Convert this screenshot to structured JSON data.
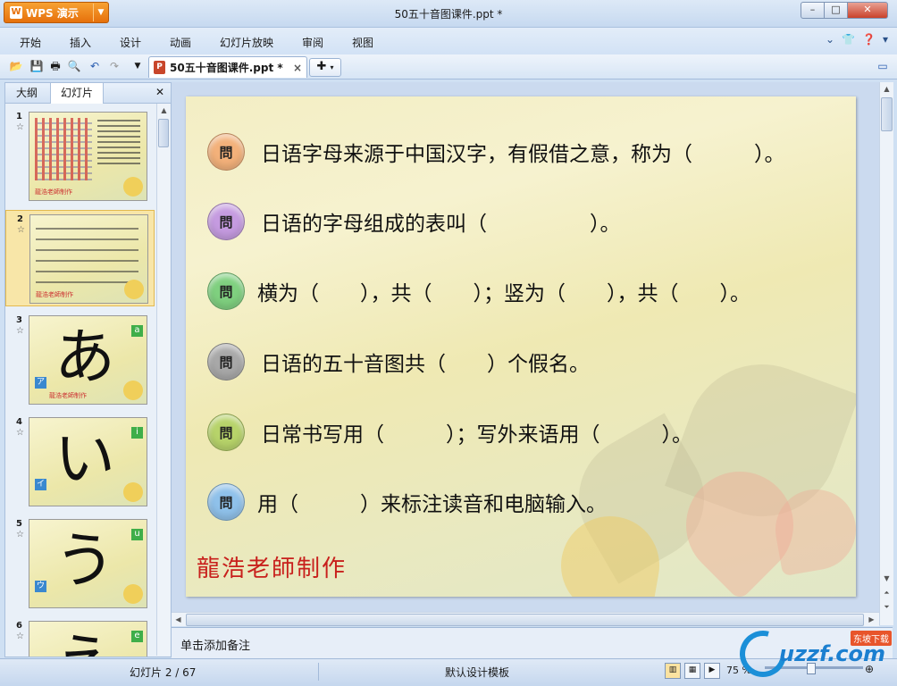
{
  "app": {
    "name": "WPS 演示",
    "doc_title": "50五十音图课件.ppt *"
  },
  "window_buttons": {
    "minimize": "–",
    "maximize": "□",
    "close": "✕"
  },
  "menu": [
    "开始",
    "插入",
    "设计",
    "动画",
    "幻灯片放映",
    "审阅",
    "视图"
  ],
  "tab": {
    "label": "50五十音图课件.ppt *"
  },
  "left_pane": {
    "tabs": [
      "大纲",
      "幻灯片"
    ],
    "thumbnails": [
      {
        "num": "1",
        "kind": "table"
      },
      {
        "num": "2",
        "kind": "questions",
        "selected": true
      },
      {
        "num": "3",
        "kana": "あ",
        "romaji": "a",
        "katakana": "ア"
      },
      {
        "num": "4",
        "kana": "い",
        "romaji": "i",
        "katakana": "イ"
      },
      {
        "num": "5",
        "kana": "う",
        "romaji": "u",
        "katakana": "ウ"
      },
      {
        "num": "6",
        "kana": "え",
        "romaji": "e",
        "katakana": ""
      }
    ]
  },
  "slide": {
    "question_icon_text": "問",
    "questions": [
      {
        "text": "日语字母来源于中国汉字，有假借之意，称为（　　　）。",
        "color": "#f3b17a"
      },
      {
        "text": "日语的字母组成的表叫（　　　　　）。",
        "color": "#c59be0"
      },
      {
        "text": "横为（　　），共（　　）；竖为（　　），共（　　）。",
        "color": "#7fd07f"
      },
      {
        "text": "日语的五十音图共（　　）个假名。",
        "color": "#a8a8a8"
      },
      {
        "text": "日常书写用（　　　）；写外来语用（　　　）。",
        "color": "#b7d36a"
      },
      {
        "text": "用（　　　）来标注读音和电脑输入。",
        "color": "#8fc1ea"
      }
    ],
    "signature": "龍浩老師制作"
  },
  "notes": {
    "placeholder": "单击添加备注"
  },
  "status": {
    "slide": "幻灯片 2 / 67",
    "template": "默认设计模板",
    "zoom": "75 %"
  },
  "watermark": {
    "brand": "uzzf.com",
    "tag": "东坡下载"
  }
}
